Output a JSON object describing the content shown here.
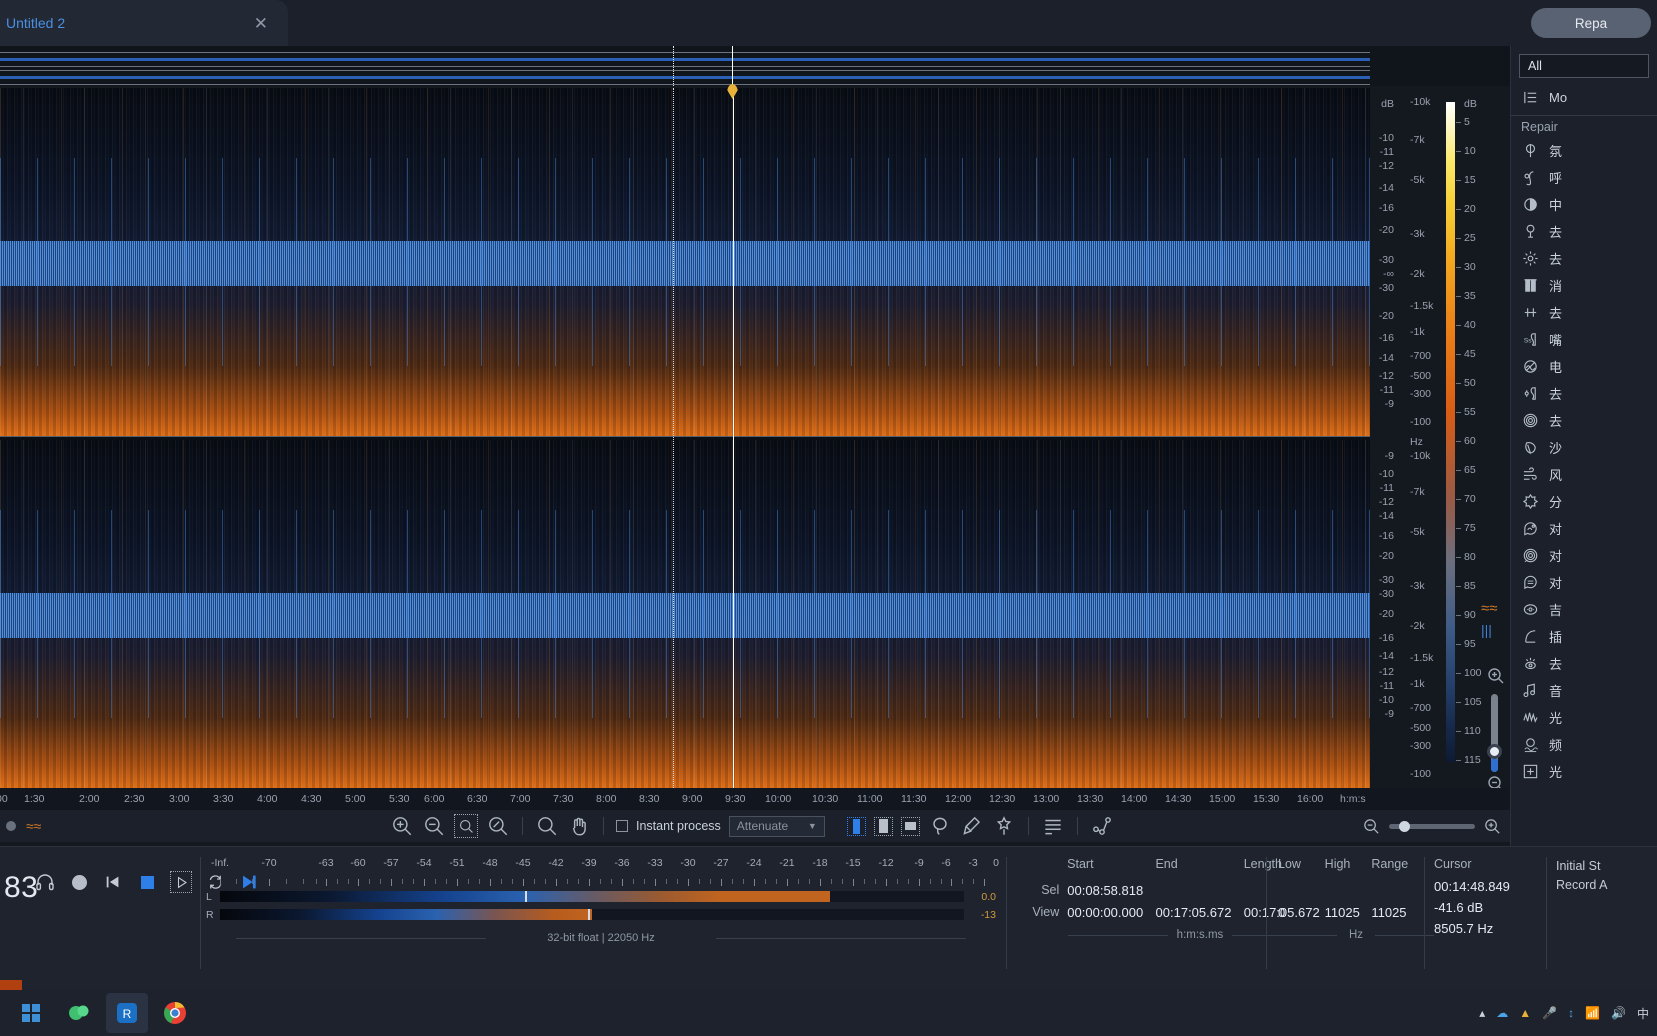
{
  "window": {
    "tab_title": "Untitled 2",
    "close_icon": "close-icon",
    "repair_button": "Repa"
  },
  "toolbar": {
    "zoom_in": "zoom-in-icon",
    "zoom_out": "zoom-out-icon",
    "zoom_selection": "zoom-to-selection-icon",
    "zoom_fit": "zoom-fit-icon",
    "magnifier": "magnifier-icon",
    "hand": "hand-pan-icon",
    "instant_process_label": "Instant process",
    "process_mode": "Attenuate",
    "select_time": "time-selection-icon",
    "select_freq": "frequency-selection-icon",
    "select_box": "box-selection-icon",
    "lasso": "lasso-select-icon",
    "magic_wand": "magic-wand-icon",
    "brush": "brush-select-icon",
    "list_icon": "list-view-icon",
    "curve_icon": "gain-envelope-icon",
    "zoom_out_small": "zoom-out-icon",
    "zoom_in_small": "zoom-in-icon"
  },
  "transport": {
    "time_display": "83",
    "headphones": "headphones-icon",
    "record": "record-icon",
    "rewind": "skip-to-start-icon",
    "stop": "stop-icon",
    "play": "play-icon",
    "loop": "loop-icon",
    "play_to_end": "play-to-end-icon"
  },
  "meters": {
    "scale": [
      "-Inf.",
      "-70",
      "-63",
      "-60",
      "-57",
      "-54",
      "-51",
      "-48",
      "-45",
      "-42",
      "-39",
      "-36",
      "-33",
      "-30",
      "-27",
      "-24",
      "-21",
      "-18",
      "-15",
      "-12",
      "-9",
      "-6",
      "-3",
      "0"
    ],
    "left_label": "L",
    "right_label": "R",
    "left_value": "0.0",
    "right_value": "-13",
    "format": "32-bit float | 22050 Hz"
  },
  "selection_panel": {
    "columns": [
      "Start",
      "End",
      "Length"
    ],
    "rows": [
      {
        "label": "Sel",
        "start": "00:08:58.818",
        "end": "",
        "length": ""
      },
      {
        "label": "View",
        "start": "00:00:00.000",
        "end": "00:17:05.672",
        "length": "00:17:05.672"
      }
    ],
    "unit": "h:m:s.ms"
  },
  "frequency_panel": {
    "columns": [
      "Low",
      "High",
      "Range"
    ],
    "rows": [
      {
        "low": "0",
        "high": "11025",
        "range": "11025"
      }
    ],
    "unit": "Hz"
  },
  "cursor_panel": {
    "title": "Cursor",
    "time": "00:14:48.849",
    "level": "-41.6 dB",
    "frequency": "8505.7 Hz"
  },
  "history_panel": {
    "lines": [
      "Initial St",
      "Record A"
    ]
  },
  "sidebar": {
    "filter": "All",
    "module_item": {
      "icon": "module-list-icon",
      "label": "Mo"
    },
    "groups": [
      {
        "name": "Repair",
        "items": [
          {
            "icon": "ambience-match-icon",
            "label": "氛"
          },
          {
            "icon": "breath-control-icon",
            "label": "呼"
          },
          {
            "icon": "center-extract-icon",
            "label": "中"
          },
          {
            "icon": "de-bleed-icon",
            "label": "去"
          },
          {
            "icon": "de-click-icon",
            "label": "去"
          },
          {
            "icon": "de-clip-icon",
            "label": "消"
          },
          {
            "icon": "de-crackle-icon",
            "label": "去"
          },
          {
            "icon": "de-ess-icon",
            "label": "嘴"
          },
          {
            "icon": "de-hum-icon",
            "label": "电"
          },
          {
            "icon": "de-plosive-icon",
            "label": "去"
          },
          {
            "icon": "de-reverb-icon",
            "label": "去"
          },
          {
            "icon": "de-rustle-icon",
            "label": "沙"
          },
          {
            "icon": "de-wind-icon",
            "label": "风"
          },
          {
            "icon": "dialogue-isolate-icon",
            "label": "分"
          },
          {
            "icon": "dialogue-contour-icon",
            "label": "对"
          },
          {
            "icon": "dialogue-dereverb-icon",
            "label": "对"
          },
          {
            "icon": "dialogue-match-icon",
            "label": "对"
          },
          {
            "icon": "guitar-denoise-icon",
            "label": "吉"
          },
          {
            "icon": "interpolate-icon",
            "label": "插"
          },
          {
            "icon": "mouth-declick-icon",
            "label": "去"
          },
          {
            "icon": "music-rebalance-icon",
            "label": "音"
          },
          {
            "icon": "spectral-denoise-icon",
            "label": "光"
          },
          {
            "icon": "spectral-repair-icon",
            "label": "频"
          },
          {
            "icon": "spectral-recovery-icon",
            "label": "光"
          }
        ]
      }
    ]
  },
  "legend": {
    "unit": "dB",
    "ticks": [
      "5",
      "10",
      "15",
      "20",
      "25",
      "30",
      "35",
      "40",
      "45",
      "50",
      "55",
      "60",
      "65",
      "70",
      "75",
      "80",
      "85",
      "90",
      "95",
      "100",
      "105",
      "110",
      "115"
    ]
  },
  "db_axis": {
    "unit": "dB",
    "ticks": [
      "-10",
      "-11",
      "-12",
      "-14",
      "-16",
      "-20",
      "-30",
      "-∞",
      "-30",
      "-20",
      "-16",
      "-14",
      "-12",
      "-11",
      "-10",
      "-9"
    ]
  },
  "hz_axis": {
    "unit": "Hz",
    "ticks": [
      "-10k",
      "-7k",
      "-5k",
      "-3k",
      "-2k",
      "-1.5k",
      "-1k",
      "-700",
      "-500",
      "-300",
      "-100"
    ]
  },
  "time_ruler": {
    "labels": [
      "00",
      "1:30",
      "2:00",
      "2:30",
      "3:00",
      "3:30",
      "4:00",
      "4:30",
      "5:00",
      "5:30",
      "6:00",
      "6:30",
      "7:00",
      "7:30",
      "8:00",
      "8:30",
      "9:00",
      "9:30",
      "10:00",
      "10:30",
      "11:00",
      "11:30",
      "12:00",
      "12:30",
      "13:00",
      "13:30",
      "14:00",
      "14:30",
      "15:00",
      "15:30",
      "16:00"
    ],
    "unit": "h:m:s"
  },
  "taskbar": {
    "apps": [
      "start-icon",
      "chat-app-icon",
      "rx-app-icon",
      "chrome-icon"
    ],
    "tray": [
      "chevron-up-icon",
      "cloud-icon",
      "shield-icon",
      "mic-icon",
      "bluetooth-icon",
      "network-icon",
      "volume-icon",
      "ime-icon"
    ],
    "ime_label": "中"
  }
}
